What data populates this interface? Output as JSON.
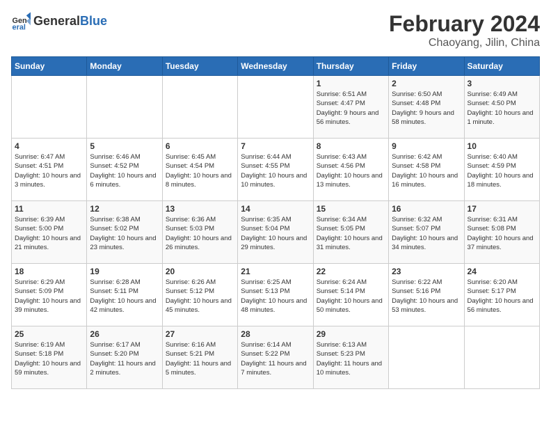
{
  "header": {
    "logo_general": "General",
    "logo_blue": "Blue",
    "title": "February 2024",
    "subtitle": "Chaoyang, Jilin, China"
  },
  "days_of_week": [
    "Sunday",
    "Monday",
    "Tuesday",
    "Wednesday",
    "Thursday",
    "Friday",
    "Saturday"
  ],
  "weeks": [
    {
      "days": [
        {
          "num": "",
          "info": ""
        },
        {
          "num": "",
          "info": ""
        },
        {
          "num": "",
          "info": ""
        },
        {
          "num": "",
          "info": ""
        },
        {
          "num": "1",
          "sunrise": "6:51 AM",
          "sunset": "4:47 PM",
          "daylight": "9 hours and 56 minutes."
        },
        {
          "num": "2",
          "sunrise": "6:50 AM",
          "sunset": "4:48 PM",
          "daylight": "9 hours and 58 minutes."
        },
        {
          "num": "3",
          "sunrise": "6:49 AM",
          "sunset": "4:50 PM",
          "daylight": "10 hours and 1 minute."
        }
      ]
    },
    {
      "days": [
        {
          "num": "4",
          "sunrise": "6:47 AM",
          "sunset": "4:51 PM",
          "daylight": "10 hours and 3 minutes."
        },
        {
          "num": "5",
          "sunrise": "6:46 AM",
          "sunset": "4:52 PM",
          "daylight": "10 hours and 6 minutes."
        },
        {
          "num": "6",
          "sunrise": "6:45 AM",
          "sunset": "4:54 PM",
          "daylight": "10 hours and 8 minutes."
        },
        {
          "num": "7",
          "sunrise": "6:44 AM",
          "sunset": "4:55 PM",
          "daylight": "10 hours and 10 minutes."
        },
        {
          "num": "8",
          "sunrise": "6:43 AM",
          "sunset": "4:56 PM",
          "daylight": "10 hours and 13 minutes."
        },
        {
          "num": "9",
          "sunrise": "6:42 AM",
          "sunset": "4:58 PM",
          "daylight": "10 hours and 16 minutes."
        },
        {
          "num": "10",
          "sunrise": "6:40 AM",
          "sunset": "4:59 PM",
          "daylight": "10 hours and 18 minutes."
        }
      ]
    },
    {
      "days": [
        {
          "num": "11",
          "sunrise": "6:39 AM",
          "sunset": "5:00 PM",
          "daylight": "10 hours and 21 minutes."
        },
        {
          "num": "12",
          "sunrise": "6:38 AM",
          "sunset": "5:02 PM",
          "daylight": "10 hours and 23 minutes."
        },
        {
          "num": "13",
          "sunrise": "6:36 AM",
          "sunset": "5:03 PM",
          "daylight": "10 hours and 26 minutes."
        },
        {
          "num": "14",
          "sunrise": "6:35 AM",
          "sunset": "5:04 PM",
          "daylight": "10 hours and 29 minutes."
        },
        {
          "num": "15",
          "sunrise": "6:34 AM",
          "sunset": "5:05 PM",
          "daylight": "10 hours and 31 minutes."
        },
        {
          "num": "16",
          "sunrise": "6:32 AM",
          "sunset": "5:07 PM",
          "daylight": "10 hours and 34 minutes."
        },
        {
          "num": "17",
          "sunrise": "6:31 AM",
          "sunset": "5:08 PM",
          "daylight": "10 hours and 37 minutes."
        }
      ]
    },
    {
      "days": [
        {
          "num": "18",
          "sunrise": "6:29 AM",
          "sunset": "5:09 PM",
          "daylight": "10 hours and 39 minutes."
        },
        {
          "num": "19",
          "sunrise": "6:28 AM",
          "sunset": "5:11 PM",
          "daylight": "10 hours and 42 minutes."
        },
        {
          "num": "20",
          "sunrise": "6:26 AM",
          "sunset": "5:12 PM",
          "daylight": "10 hours and 45 minutes."
        },
        {
          "num": "21",
          "sunrise": "6:25 AM",
          "sunset": "5:13 PM",
          "daylight": "10 hours and 48 minutes."
        },
        {
          "num": "22",
          "sunrise": "6:24 AM",
          "sunset": "5:14 PM",
          "daylight": "10 hours and 50 minutes."
        },
        {
          "num": "23",
          "sunrise": "6:22 AM",
          "sunset": "5:16 PM",
          "daylight": "10 hours and 53 minutes."
        },
        {
          "num": "24",
          "sunrise": "6:20 AM",
          "sunset": "5:17 PM",
          "daylight": "10 hours and 56 minutes."
        }
      ]
    },
    {
      "days": [
        {
          "num": "25",
          "sunrise": "6:19 AM",
          "sunset": "5:18 PM",
          "daylight": "10 hours and 59 minutes."
        },
        {
          "num": "26",
          "sunrise": "6:17 AM",
          "sunset": "5:20 PM",
          "daylight": "11 hours and 2 minutes."
        },
        {
          "num": "27",
          "sunrise": "6:16 AM",
          "sunset": "5:21 PM",
          "daylight": "11 hours and 5 minutes."
        },
        {
          "num": "28",
          "sunrise": "6:14 AM",
          "sunset": "5:22 PM",
          "daylight": "11 hours and 7 minutes."
        },
        {
          "num": "29",
          "sunrise": "6:13 AM",
          "sunset": "5:23 PM",
          "daylight": "11 hours and 10 minutes."
        },
        {
          "num": "",
          "info": ""
        },
        {
          "num": "",
          "info": ""
        }
      ]
    }
  ],
  "labels": {
    "sunrise": "Sunrise:",
    "sunset": "Sunset:",
    "daylight": "Daylight:"
  },
  "colors": {
    "header_bg": "#2a6db5",
    "header_text": "#ffffff"
  }
}
